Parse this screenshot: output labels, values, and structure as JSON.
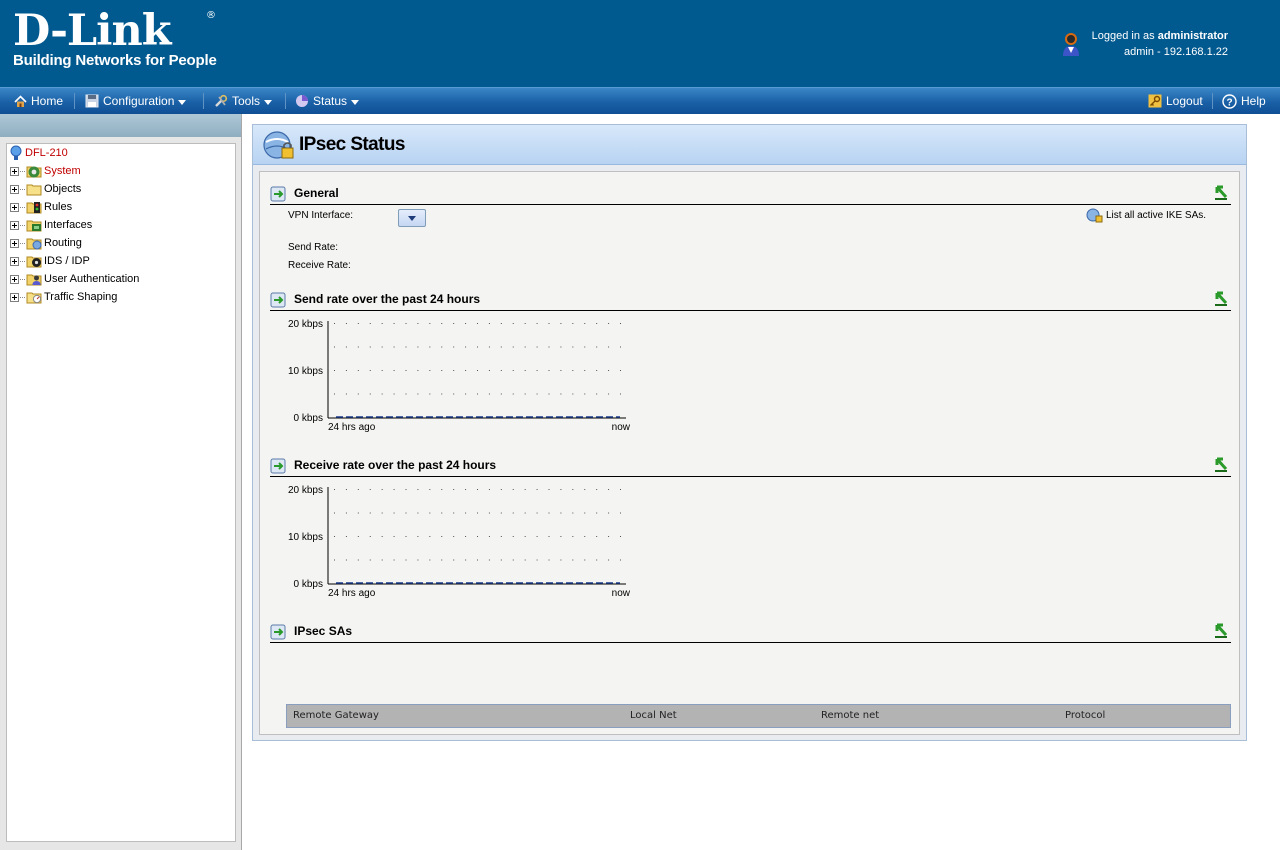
{
  "header": {
    "brand": "D-Link",
    "registered": "®",
    "tagline": "Building Networks for People",
    "logged_in_prefix": "Logged in as ",
    "username": "administrator",
    "session": "admin - 192.168.1.22"
  },
  "nav": {
    "home": "Home",
    "configuration": "Configuration",
    "tools": "Tools",
    "status": "Status",
    "logout": "Logout",
    "help": "Help"
  },
  "tree": {
    "root": "DFL-210",
    "items": [
      {
        "label": "System",
        "icon": "gear-folder-icon",
        "active": true
      },
      {
        "label": "Objects",
        "icon": "folder-icon"
      },
      {
        "label": "Rules",
        "icon": "rules-folder-icon"
      },
      {
        "label": "Interfaces",
        "icon": "interfaces-folder-icon"
      },
      {
        "label": "Routing",
        "icon": "routing-folder-icon"
      },
      {
        "label": "IDS / IDP",
        "icon": "ids-folder-icon"
      },
      {
        "label": "User Authentication",
        "icon": "user-folder-icon"
      },
      {
        "label": "Traffic Shaping",
        "icon": "shaping-folder-icon"
      }
    ]
  },
  "page": {
    "title": "IPsec Status"
  },
  "general": {
    "title": "General",
    "vpn_interface_label": "VPN Interface:",
    "send_rate_label": "Send Rate:",
    "receive_rate_label": "Receive Rate:",
    "ike_link": "List all active IKE SAs."
  },
  "send_chart": {
    "title": "Send rate over the past 24 hours"
  },
  "receive_chart": {
    "title": "Receive rate over the past 24 hours"
  },
  "ipsec_sas": {
    "title": "IPsec SAs",
    "columns": [
      "Remote Gateway",
      "Local Net",
      "Remote net",
      "Protocol"
    ]
  },
  "chart_data": [
    {
      "type": "line",
      "series": [
        {
          "values": [
            0,
            0,
            0,
            0,
            0,
            0,
            0,
            0,
            0,
            0,
            0,
            0,
            0,
            0,
            0,
            0,
            0,
            0,
            0,
            0,
            0,
            0,
            0,
            0,
            0
          ]
        }
      ],
      "x": [
        "24 hrs ago",
        "",
        "",
        "",
        "",
        "",
        "",
        "",
        "",
        "",
        "",
        "",
        "",
        "",
        "",
        "",
        "",
        "",
        "",
        "",
        "",
        "",
        "",
        "",
        "now"
      ],
      "yticks": [
        "0 kbps",
        "10 kbps",
        "20 kbps"
      ],
      "ylim": [
        0,
        20
      ],
      "grid": true
    },
    {
      "type": "line",
      "series": [
        {
          "values": [
            0,
            0,
            0,
            0,
            0,
            0,
            0,
            0,
            0,
            0,
            0,
            0,
            0,
            0,
            0,
            0,
            0,
            0,
            0,
            0,
            0,
            0,
            0,
            0,
            0
          ]
        }
      ],
      "x": [
        "24 hrs ago",
        "",
        "",
        "",
        "",
        "",
        "",
        "",
        "",
        "",
        "",
        "",
        "",
        "",
        "",
        "",
        "",
        "",
        "",
        "",
        "",
        "",
        "",
        "",
        "now"
      ],
      "yticks": [
        "0 kbps",
        "10 kbps",
        "20 kbps"
      ],
      "ylim": [
        0,
        20
      ],
      "grid": true
    }
  ]
}
